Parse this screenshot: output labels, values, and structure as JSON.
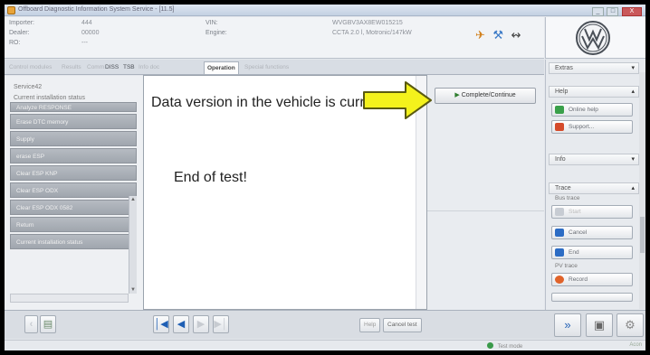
{
  "window": {
    "title": "Offboard Diagnostic Information System Service - [11.5]",
    "controls": [
      "_",
      "□",
      "X"
    ]
  },
  "header": {
    "importer_label": "Importer:",
    "importer_value": "444",
    "dealer_label": "Dealer:",
    "dealer_value": "00000",
    "ro_label": "RO:",
    "ro_value": "---",
    "vin_label": "VIN:",
    "vin_value": "WVGBV3AX8EW015215",
    "engine_label": "Engine:",
    "engine_value": "CCTA 2.0 l, Motronic/147kW",
    "icons": [
      "vehicle-icon",
      "tools-icon",
      "connection-icon"
    ]
  },
  "brand": {
    "logo": "vw-logo"
  },
  "tabs": [
    {
      "label": "Control modules"
    },
    {
      "label": "Results"
    },
    {
      "label": "Comm"
    },
    {
      "label": "DISS"
    },
    {
      "label": "TSB"
    },
    {
      "label": "Info doc"
    },
    {
      "label": "Operation"
    },
    {
      "label": "Special functions"
    }
  ],
  "left_pane": {
    "heading": "Service42",
    "subheading": "Current installation status",
    "items": [
      "Analyze RESPONSE",
      "Erase DTC memory",
      "Supply",
      "erase ESP",
      "Clear ESP KNP",
      "Clear ESP ODX",
      "Clear ESP ODX 0582",
      "Return",
      "Current installation status"
    ]
  },
  "message": {
    "line1": "Data version in the vehicle is current.",
    "line2": "End of test!"
  },
  "complete_button": {
    "label": "Complete/Continue"
  },
  "sidebar": {
    "extras_label": "Extras",
    "help_label": "Help",
    "online_help_label": "Online help",
    "support_label": "Support...",
    "info_label": "Info",
    "trace_label": "Trace",
    "bus_trace_label": "Bus trace",
    "start_label": "Start",
    "cancel_label": "Cancel",
    "end_label": "End",
    "pv_trace_label": "PV trace",
    "record_label": "Record"
  },
  "bottombar": {
    "help_label": "Help",
    "cancel_test_label": "Cancel test"
  },
  "status": {
    "network_label": "Test mode",
    "right_label": "Acon"
  },
  "colors": {
    "arrow_fill": "#f4f21c",
    "arrow_stroke": "#5a5a10",
    "nav_blue": "#1f5fb4",
    "list_grey": "#a6acb3"
  }
}
